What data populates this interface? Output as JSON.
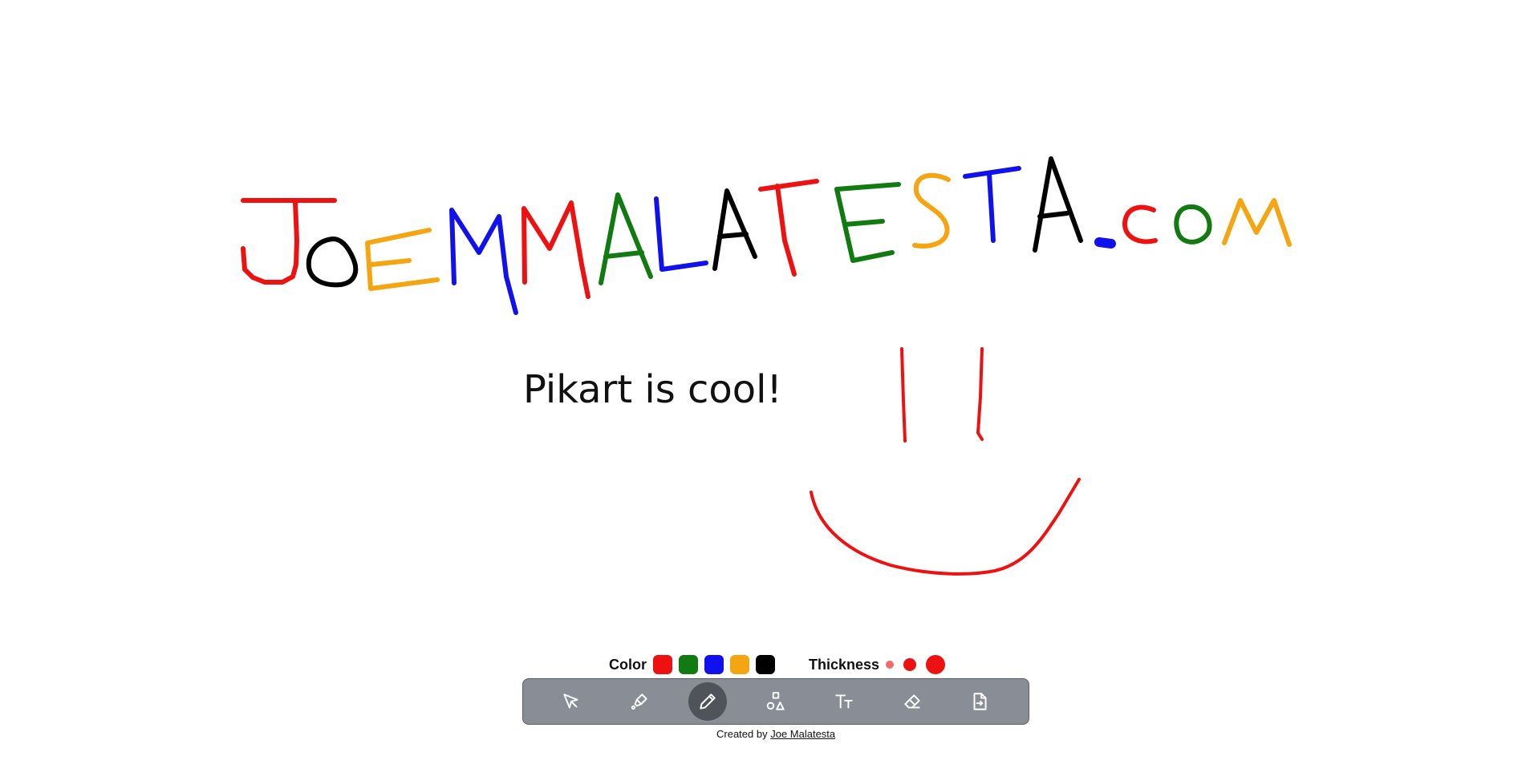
{
  "canvas": {
    "text_object": "Pikart is cool!",
    "logo_text": "JoeMMalatesta.com"
  },
  "colors": {
    "label": "Color",
    "swatches": [
      {
        "name": "red",
        "hex": "#ee1111"
      },
      {
        "name": "green",
        "hex": "#117a11"
      },
      {
        "name": "blue",
        "hex": "#1111ee"
      },
      {
        "name": "orange",
        "hex": "#f5a511"
      },
      {
        "name": "black",
        "hex": "#000000"
      }
    ]
  },
  "thickness": {
    "label": "Thickness",
    "options": [
      "small",
      "medium",
      "large"
    ]
  },
  "toolbar": {
    "tools": [
      {
        "name": "select",
        "icon": "cursor-arrow-icon"
      },
      {
        "name": "fill",
        "icon": "paint-bucket-icon"
      },
      {
        "name": "pencil",
        "icon": "pencil-icon",
        "active": true
      },
      {
        "name": "shapes",
        "icon": "shapes-icon"
      },
      {
        "name": "text",
        "icon": "text-size-icon"
      },
      {
        "name": "eraser",
        "icon": "eraser-icon"
      },
      {
        "name": "export",
        "icon": "file-export-icon"
      }
    ]
  },
  "footer": {
    "prefix": "Created by",
    "author": "Joe Malatesta"
  }
}
